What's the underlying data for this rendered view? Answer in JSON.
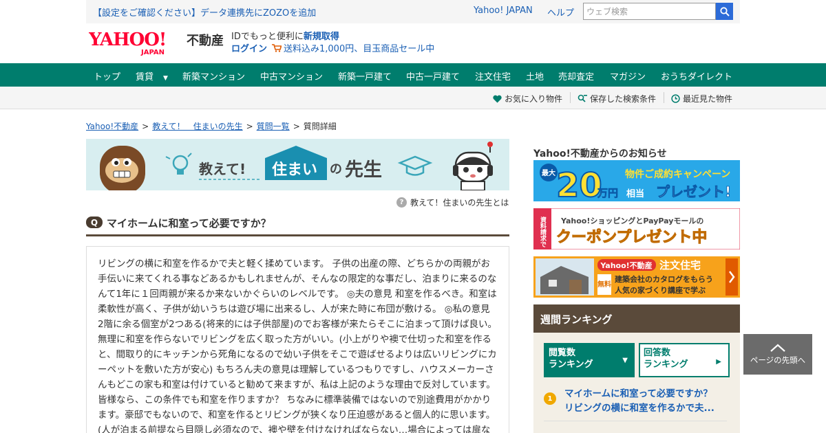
{
  "topbar": {
    "notice": "【設定をご確認ください】データ連携先にZOZOを追加",
    "yahoo_japan": "Yahoo! JAPAN",
    "help": "ヘルプ",
    "search_placeholder": "ウェブ検索"
  },
  "header": {
    "logo_text": "YAHOO!",
    "logo_sub": "JAPAN",
    "site_name": "不動産",
    "id_prefix": "IDでもっと便利に",
    "signup": "新規取得",
    "login": "ログイン",
    "promo": "送料込み1,000円、目玉商品セール中"
  },
  "nav": {
    "items": [
      "トップ",
      "賃貸",
      "新築マンション",
      "中古マンション",
      "新築一戸建て",
      "中古一戸建て",
      "注文住宅",
      "土地",
      "売却査定",
      "マガジン",
      "おうちダイレクト"
    ],
    "caret": "▼"
  },
  "subnav": {
    "favorites": "お気に入り物件",
    "saved_search": "保存した検索条件",
    "recent": "最近見た物件"
  },
  "breadcrumb": {
    "items": [
      "Yahoo!不動産",
      "教えて！　住まいの先生",
      "質問一覧",
      "質問詳細"
    ],
    "separator": ">"
  },
  "banner": {
    "text_oshiete": "教えて!",
    "text_sumai": "住まい",
    "text_no": "の",
    "text_sensei": "先生"
  },
  "about": {
    "icon_glyph": "?",
    "label": "教えて！住まいの先生とは"
  },
  "question": {
    "badge": "Q",
    "title": "マイホームに和室って必要ですか？",
    "body": "リビングの横に和室を作るかで夫と軽く揉めています。 子供の出産の際、どちらかの両親がお手伝いに来てくれる事などあるかもしれませんが、そんなの限定的な事だし、泊まりに来るのなんて1年に１回両親が来るか来ないかぐらいのレベルです。 ◎夫の意見 和室を作るべき。和室は柔軟性が高く、子供が幼いうちは遊び場に出来るし、人が来た時に布団が敷ける。 ◎私の意見 2階に余る個室が2つある(将来的には子供部屋)のでお客様が来たらそこに泊まって頂けば良い。無理に和室を作らないでリビングを広く取った方がいい。(小上がりや襖で仕切った和室を作ると、間取り的にキッチンから死角になるので幼い子供をそこで遊ばせるよりは広いリビングにカーペットを敷いた方が安心) もちろん夫の意見は理解しているつもりですし、ハウスメーカーさんもどこの家も和室は付けていると勧めて来ますが、私は上記のような理由で反対しています。 皆様なら、この条件でも和室を作りますか？ ちなみに標準装備ではないので別途費用がかかります。豪邸でもないので、和室を作るとリビングが狭くなり圧迫感があると個人的に思います。(人が泊まる前提なら目隠し必須なので、襖や壁を付けなければならない…場合によっては扉などが必要)"
  },
  "sidebar": {
    "notice_title": "Yahoo!不動産からのお知らせ",
    "ad1": {
      "badge": "最大",
      "number": "20",
      "unit": "万円",
      "sub": "相当",
      "line1": "物件ご成約キャンペーン",
      "line2": "プレゼント!"
    },
    "ad2": {
      "side": "資料請求で",
      "line1": "Yahoo!ショッピングとPayPayモールの",
      "line2": "クーポンプレゼント中"
    },
    "ad3": {
      "brand": "Yahoo!不動産",
      "title": "注文住宅",
      "free": "無料",
      "line1": "建築会社のカタログをもらう",
      "line2": "人気の家づくり講座で学ぶ"
    },
    "ranking": {
      "header": "週間ランキング",
      "tab_views_1": "閲覧数",
      "tab_views_2": "ランキング",
      "tab_answers_1": "回答数",
      "tab_answers_2": "ランキング",
      "tab_views_arrow": "▼",
      "tab_answers_arrow": "▶",
      "item1_num": "1",
      "item1_title": "マイホームに和室って必要ですか？",
      "item1_excerpt": "リビングの横に和室を作るかで夫..."
    }
  },
  "back_to_top": "ページの先頭へ",
  "colors": {
    "nav_green": "#007d6d",
    "link_blue": "#1a5fb4",
    "brown": "#5a4a3a",
    "yahoo_red": "#ff0033"
  }
}
